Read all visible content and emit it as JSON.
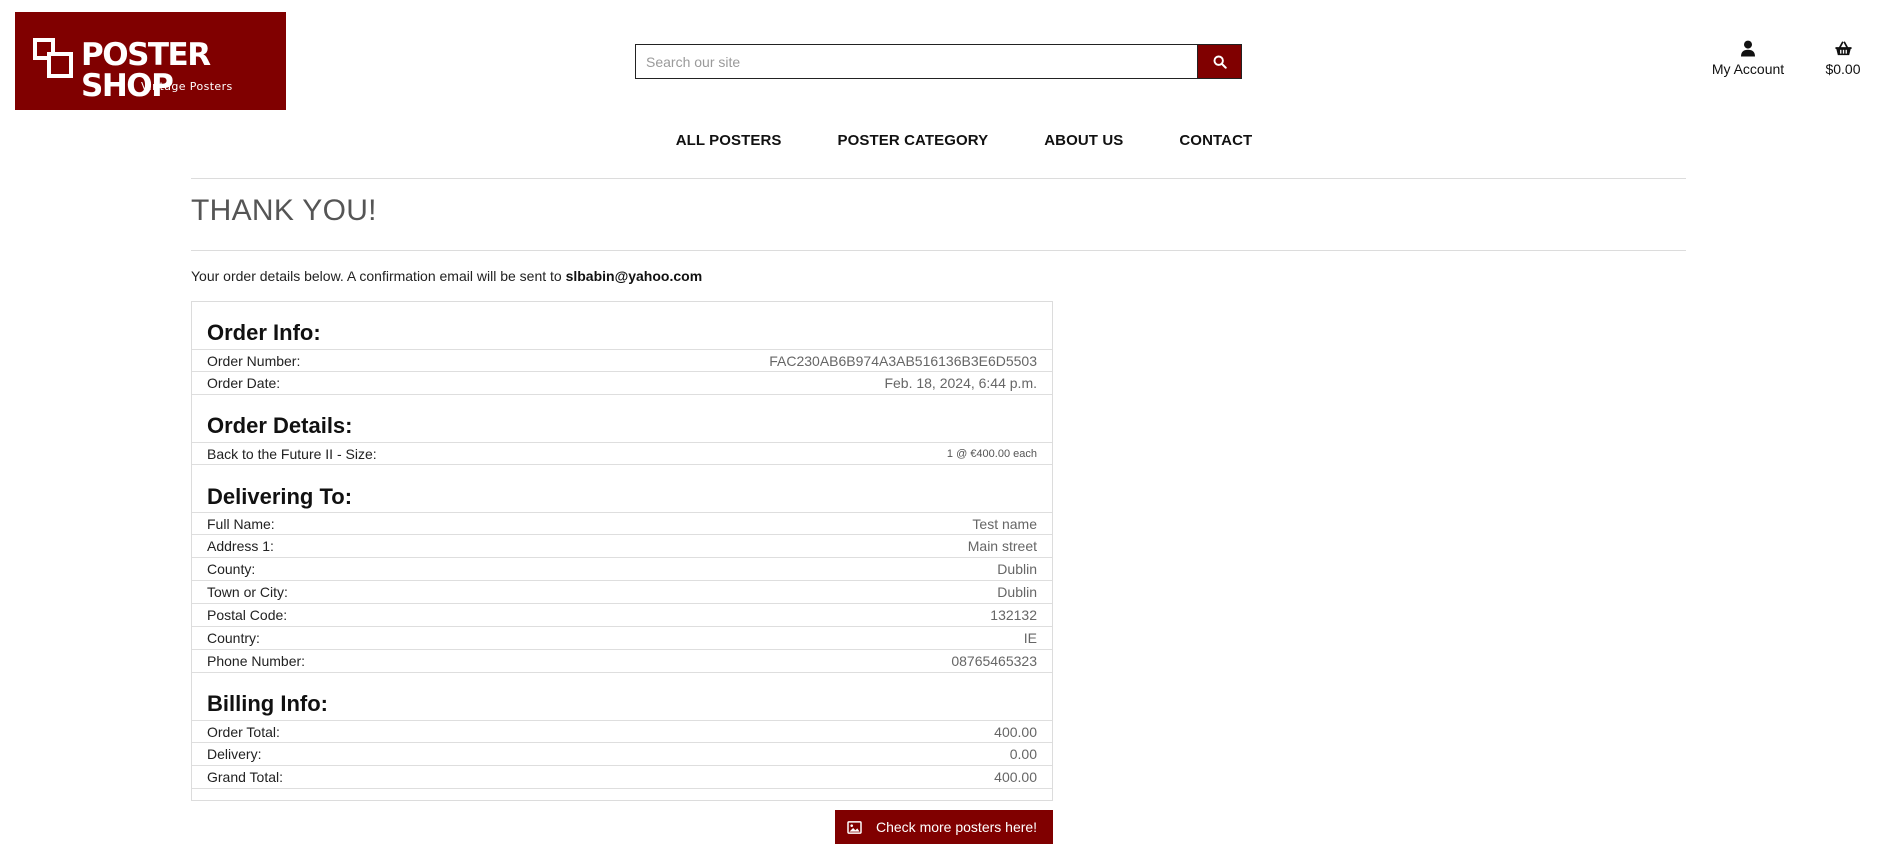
{
  "brand": {
    "name": "POSTER SHOP",
    "tagline": "Vintage Posters",
    "color": "#800000"
  },
  "search": {
    "placeholder": "Search our site",
    "button_icon": "search-icon"
  },
  "account": {
    "label": "My Account",
    "icon": "user-icon"
  },
  "cart": {
    "label": "$0.00",
    "icon": "basket-icon"
  },
  "nav": {
    "items": [
      {
        "label": "ALL POSTERS"
      },
      {
        "label": "POSTER CATEGORY"
      },
      {
        "label": "ABOUT US"
      },
      {
        "label": "CONTACT"
      }
    ]
  },
  "page": {
    "title": "THANK YOU!",
    "intro_text": "Your order details below. A confirmation email will be sent to ",
    "email": "slbabin@yahoo.com"
  },
  "order_info": {
    "title": "Order Info:",
    "rows": [
      {
        "label": "Order Number:",
        "value": "FAC230AB6B974A3AB516136B3E6D5503"
      },
      {
        "label": "Order Date:",
        "value": "Feb. 18, 2024, 6:44 p.m."
      }
    ]
  },
  "order_details": {
    "title": "Order Details:",
    "rows": [
      {
        "label": "Back to the Future II - Size:",
        "value": "1 @ €400.00 each"
      }
    ]
  },
  "delivering_to": {
    "title": "Delivering To:",
    "rows": [
      {
        "label": "Full Name:",
        "value": "Test name"
      },
      {
        "label": "Address 1:",
        "value": "Main street"
      },
      {
        "label": "County:",
        "value": "Dublin"
      },
      {
        "label": "Town or City:",
        "value": "Dublin"
      },
      {
        "label": "Postal Code:",
        "value": "132132"
      },
      {
        "label": "Country:",
        "value": "IE"
      },
      {
        "label": "Phone Number:",
        "value": "08765465323"
      }
    ]
  },
  "billing_info": {
    "title": "Billing Info:",
    "rows": [
      {
        "label": "Order Total:",
        "value": "400.00"
      },
      {
        "label": "Delivery:",
        "value": "0.00"
      },
      {
        "label": "Grand Total:",
        "value": "400.00"
      }
    ]
  },
  "cta": {
    "label": "Check more posters here!",
    "icon": "image-icon"
  }
}
